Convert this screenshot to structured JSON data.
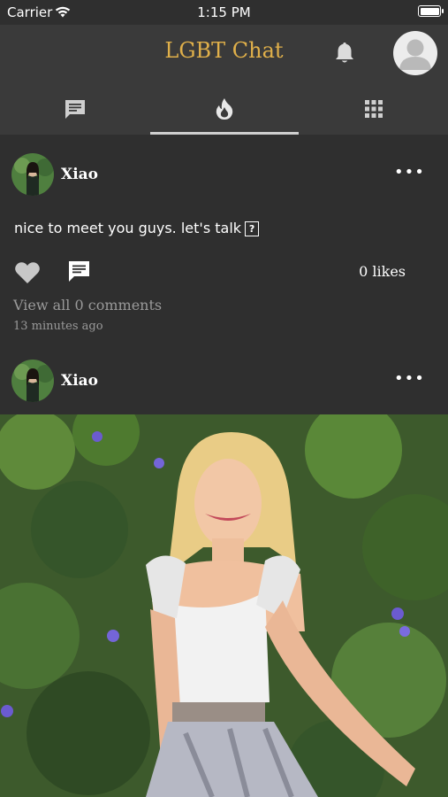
{
  "status": {
    "carrier": "Carrier",
    "time": "1:15 PM"
  },
  "header": {
    "title": "LGBT Chat"
  },
  "tabs": [
    {
      "name": "chat-tab",
      "icon": "chat-icon"
    },
    {
      "name": "feed-tab",
      "icon": "flame-icon",
      "active": true
    },
    {
      "name": "grid-tab",
      "icon": "grid-icon"
    }
  ],
  "posts": [
    {
      "username": "Xiao",
      "text": "nice to meet you guys. let's talk",
      "likes": "0 likes",
      "view_comments": "View all 0 comments",
      "time": "13 minutes ago"
    },
    {
      "username": "Xiao"
    }
  ],
  "colors": {
    "accent": "#e0b04a",
    "header_bg": "#3a3a3a",
    "feed_bg": "#2f2f2f"
  }
}
